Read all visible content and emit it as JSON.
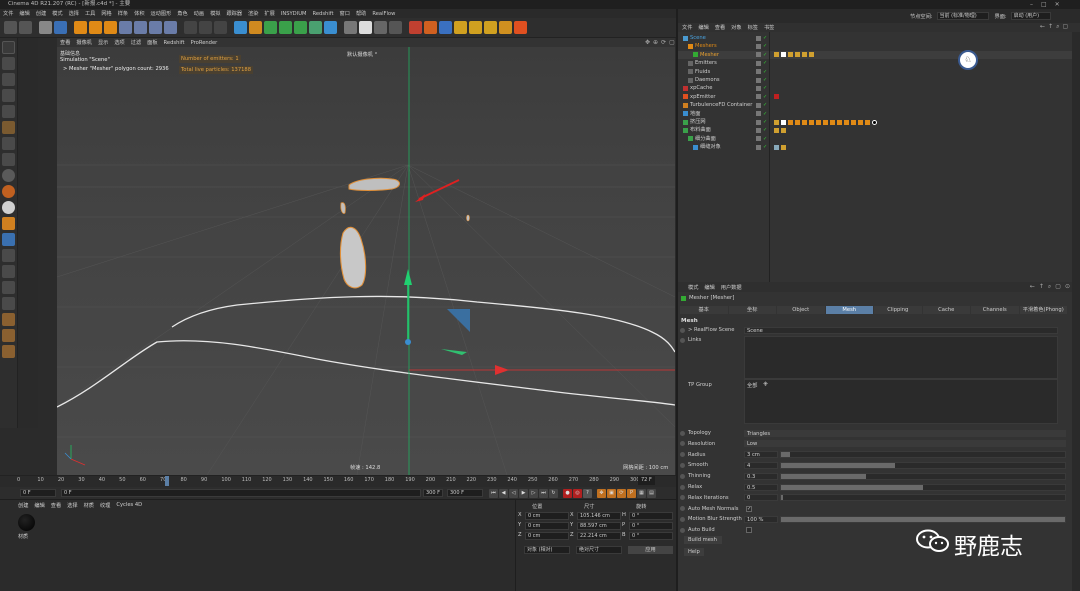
{
  "title": "Cinema 4D R21.207 (RC) - [新报.c4d *] - 主要",
  "menu": [
    "文件",
    "编辑",
    "创建",
    "模式",
    "选择",
    "工具",
    "网格",
    "样条",
    "体积",
    "运动图形",
    "角色",
    "动画",
    "模拟",
    "跟踪器",
    "渲染",
    "扩展",
    "INSYDIUM",
    "Redshift",
    "窗口",
    "帮助",
    "RealFlow"
  ],
  "toolbar_icons": [
    {
      "name": "undo-icon",
      "color": "#555"
    },
    {
      "name": "redo-icon",
      "color": "#555"
    },
    {
      "name": "live-select-icon",
      "color": "#888"
    },
    {
      "name": "move-icon",
      "color": "#3a6fb5"
    },
    {
      "name": "scale-icon",
      "color": "#e08a16"
    },
    {
      "name": "rotate-icon",
      "color": "#e08a16"
    },
    {
      "name": "coordinate-icon",
      "color": "#e08a16"
    },
    {
      "name": "x-axis-icon",
      "color": "#6a7ca8"
    },
    {
      "name": "y-axis-icon",
      "color": "#6a7ca8"
    },
    {
      "name": "z-axis-icon",
      "color": "#6a7ca8"
    },
    {
      "name": "world-icon",
      "color": "#6a7ca8"
    },
    {
      "name": "render-region-icon",
      "color": "#444"
    },
    {
      "name": "render-view-icon",
      "color": "#444"
    },
    {
      "name": "render-settings-icon",
      "color": "#444"
    },
    {
      "name": "cube-icon",
      "color": "#3a8ed0"
    },
    {
      "name": "pen-icon",
      "color": "#d08a20"
    },
    {
      "name": "subdivision-icon",
      "color": "#3aa04a"
    },
    {
      "name": "array-icon",
      "color": "#3aa04a"
    },
    {
      "name": "deformer-icon",
      "color": "#3aa04a"
    },
    {
      "name": "cloner-icon",
      "color": "#4aa070"
    },
    {
      "name": "floor-icon",
      "color": "#3a8ed0"
    },
    {
      "name": "camera-icon",
      "color": "#777"
    },
    {
      "name": "light-icon",
      "color": "#ddd"
    },
    {
      "name": "fx-icon",
      "color": "#666"
    },
    {
      "name": "grid-icon",
      "color": "#555"
    },
    {
      "name": "redshift-icon",
      "color": "#c04030"
    },
    {
      "name": "rf-icon",
      "color": "#d06020"
    },
    {
      "name": "qr-icon",
      "color": "#3a70c0"
    },
    {
      "name": "tp-icon",
      "color": "#d0a020"
    },
    {
      "name": "emitter-icon",
      "color": "#d0a020"
    },
    {
      "name": "target-icon",
      "color": "#d0a020"
    },
    {
      "name": "scene-icon",
      "color": "#d09020"
    },
    {
      "name": "x-particles-icon",
      "color": "#e05020"
    }
  ],
  "viewport": {
    "menu": [
      "查看",
      "摄像机",
      "显示",
      "选项",
      "过滤",
      "面板",
      "Redshift",
      "ProRender"
    ],
    "stats_title": "基础信息",
    "stats_line1": "Simulation \"Scene\"",
    "stats_line2": "> Mesher \"Mesher\" polygon count: 2936",
    "emitters_label": "Number of emitters: 1",
    "particles_label": "Total live particles: 137188",
    "camera_label": "默认摄像机 °",
    "fps_label": "帧速 : 142.8",
    "grid_label": "网格间距 : 100 cm"
  },
  "timeline": {
    "ticks": [
      "0",
      "10",
      "20",
      "30",
      "40",
      "50",
      "60",
      "70",
      "80",
      "90",
      "100",
      "110",
      "120",
      "130",
      "140",
      "150",
      "160",
      "170",
      "180",
      "190",
      "200",
      "210",
      "220",
      "230",
      "240",
      "250",
      "260",
      "270",
      "280",
      "290",
      "300"
    ],
    "frame_badge": "72 F",
    "current": "0 F",
    "start": "0 F",
    "end": "300 F",
    "end2": "300 F",
    "cursor_frame": 72
  },
  "material": {
    "menu": [
      "创建",
      "编辑",
      "查看",
      "选择",
      "材质",
      "纹理",
      "Cycles 4D"
    ],
    "mat_name": "材质"
  },
  "coords": {
    "headers": [
      "位置",
      "尺寸",
      "旋转"
    ],
    "rows": [
      {
        "axis": "X",
        "pos": "0 cm",
        "size_axis": "X",
        "size": "105.146 cm",
        "rot_axis": "H",
        "rot": "0 °"
      },
      {
        "axis": "Y",
        "pos": "0 cm",
        "size_axis": "Y",
        "size": "88.597 cm",
        "rot_axis": "P",
        "rot": "0 °"
      },
      {
        "axis": "Z",
        "pos": "0 cm",
        "size_axis": "Z",
        "size": "22.214 cm",
        "rot_axis": "B",
        "rot": "0 °"
      }
    ],
    "mode1": "对象 (相对)",
    "mode2": "绝对尺寸",
    "apply": "应用"
  },
  "obj_manager": {
    "layout_label": "节点空间:",
    "layout_value": "当前 (标准/物理)",
    "interface_label": "界面:",
    "interface_value": "启动 (用户)",
    "menu": [
      "文件",
      "编辑",
      "查看",
      "对象",
      "标签",
      "书签"
    ],
    "objects": [
      {
        "name": "Scene",
        "indent": 0,
        "color": "#4aa3e0",
        "icon": "#4a9ad0"
      },
      {
        "name": "Meshers",
        "indent": 1,
        "color": "#e08a16",
        "icon": "#e08a16"
      },
      {
        "name": "Mesher",
        "indent": 2,
        "color": "#e8a030",
        "icon": "#3a3",
        "selected": true
      },
      {
        "name": "Emitters",
        "indent": 1,
        "color": "#cfcfcf",
        "icon": "#666"
      },
      {
        "name": "Fluids",
        "indent": 1,
        "color": "#cfcfcf",
        "icon": "#666"
      },
      {
        "name": "Daemons",
        "indent": 1,
        "color": "#cfcfcf",
        "icon": "#666"
      },
      {
        "name": "xpCache",
        "indent": 0,
        "color": "#cfcfcf",
        "icon": "#c03030"
      },
      {
        "name": "xpEmitter",
        "indent": 0,
        "color": "#cfcfcf",
        "icon": "#e05020"
      },
      {
        "name": "TurbulenceFD Container",
        "indent": 0,
        "color": "#cfcfcf",
        "icon": "#d08020"
      },
      {
        "name": "地面",
        "indent": 0,
        "color": "#cfcfcf",
        "icon": "#3a8ed0"
      },
      {
        "name": "挤压网",
        "indent": 0,
        "color": "#cfcfcf",
        "icon": "#3aa04a"
      },
      {
        "name": "布料曲面",
        "indent": 0,
        "color": "#cfcfcf",
        "icon": "#3aa04a"
      },
      {
        "name": "细分曲面",
        "indent": 1,
        "color": "#cfcfcf",
        "icon": "#3aa04a"
      },
      {
        "name": "细缝对象",
        "indent": 2,
        "color": "#cfcfcf",
        "icon": "#3a8ed0"
      }
    ]
  },
  "attributes": {
    "menu": [
      "模式",
      "编辑",
      "用户数据"
    ],
    "object_title": "Mesher [Mesher]",
    "tabs": [
      "基本",
      "坐标",
      "Object",
      "Mesh",
      "Clipping",
      "Cache",
      "Channels",
      "平滑着色(Phong)"
    ],
    "active_tab": "Mesh",
    "section": "Mesh",
    "realflow_label": "> RealFlow Scene",
    "realflow_value": "Scene",
    "links_label": "Links",
    "tp_label": "TP Group",
    "tp_value": "全部",
    "params": [
      {
        "label": "Topology",
        "value": "Triangles",
        "type": "dropdown"
      },
      {
        "label": "Resolution",
        "value": "Low",
        "type": "dropdown"
      },
      {
        "label": "Radius",
        "value": "3 cm",
        "type": "slider",
        "fill": 0.03
      },
      {
        "label": "Smooth",
        "value": "4",
        "type": "slider",
        "fill": 0.4
      },
      {
        "label": "Thinning",
        "value": "0.3",
        "type": "slider",
        "fill": 0.3
      },
      {
        "label": "Relax",
        "value": "0.5",
        "type": "slider",
        "fill": 0.5
      },
      {
        "label": "Relax Iterations",
        "value": "0",
        "type": "slider",
        "fill": 0
      },
      {
        "label": "Auto Mesh Normals",
        "value": "✓",
        "type": "check"
      },
      {
        "label": "Motion Blur Strength",
        "value": "100 %",
        "type": "slider",
        "fill": 1
      },
      {
        "label": "Auto Build",
        "value": "",
        "type": "check"
      }
    ],
    "build_button": "Build mesh",
    "help_button": "Help"
  },
  "watermark": "野鹿志",
  "colors": {
    "accent": "#e08a16",
    "selected_tab": "#5b7fa6",
    "arrow_red": "#e02020",
    "axis_green": "#20c060",
    "axis_red": "#e03030",
    "axis_blue": "#3a8ed0"
  }
}
